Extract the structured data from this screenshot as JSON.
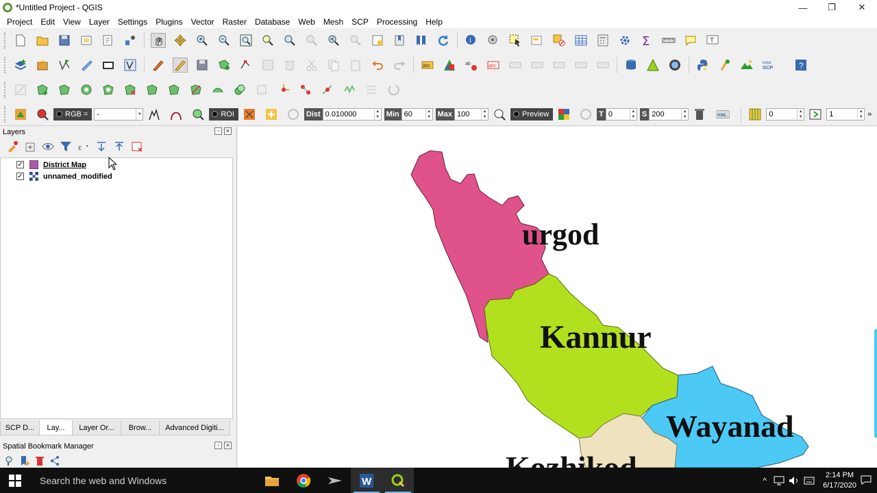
{
  "window": {
    "title": "*Untitled Project - QGIS",
    "minimize": "—",
    "restore": "❐",
    "close": "✕"
  },
  "menu": [
    "Project",
    "Edit",
    "View",
    "Layer",
    "Settings",
    "Plugins",
    "Vector",
    "Raster",
    "Database",
    "Web",
    "Mesh",
    "SCP",
    "Processing",
    "Help"
  ],
  "scp_toolbar": {
    "rgb_label": "RGB =",
    "rgb_value": "-",
    "roi_label": "ROI",
    "dist_label": "Dist",
    "dist_value": "0.010000",
    "min_label": "Min",
    "min_value": "60",
    "max_label": "Max",
    "max_value": "100",
    "preview_label": "Preview",
    "t_label": "T",
    "t_value": "0",
    "s_label": "S",
    "s_value": "200",
    "kml_label": "KML",
    "band_value": "0",
    "step_value": "1",
    "more": "»"
  },
  "layers_panel": {
    "title": "Layers",
    "layers": [
      {
        "name": "District Map",
        "checked": true,
        "icon": "vector-polygon-icon"
      },
      {
        "name": "unnamed_modified",
        "checked": true,
        "icon": "raster-icon"
      }
    ],
    "check_mark": "✓"
  },
  "dock_tabs": [
    "SCP D...",
    "Lay...",
    "Layer Or...",
    "Brow...",
    "Advanced Digiti..."
  ],
  "active_tab": "Lay...",
  "bookmark_panel": {
    "title": "Spatial Bookmark Manager"
  },
  "map": {
    "labels": [
      "Kasargod",
      "Kannur",
      "Wayanad",
      "Kozhikode"
    ],
    "visible_label_text": {
      "kasargod": "urgod",
      "kannur": "Kannur",
      "wayanad": "Wayanad",
      "kozhikode": "Kozhikod"
    },
    "colors": {
      "kasargod": "#e0528a",
      "kannur": "#b3e01e",
      "wayanad": "#4dc9f6",
      "kozhikode": "#efe3bf"
    }
  },
  "taskbar": {
    "search_placeholder": "Search the web and Windows",
    "time": "2:14 PM",
    "date": "6/17/2020",
    "apps": [
      "file-explorer-icon",
      "chrome-icon",
      "app-arrow-icon",
      "word-icon",
      "qgis-icon"
    ],
    "active_app": "qgis-icon"
  }
}
